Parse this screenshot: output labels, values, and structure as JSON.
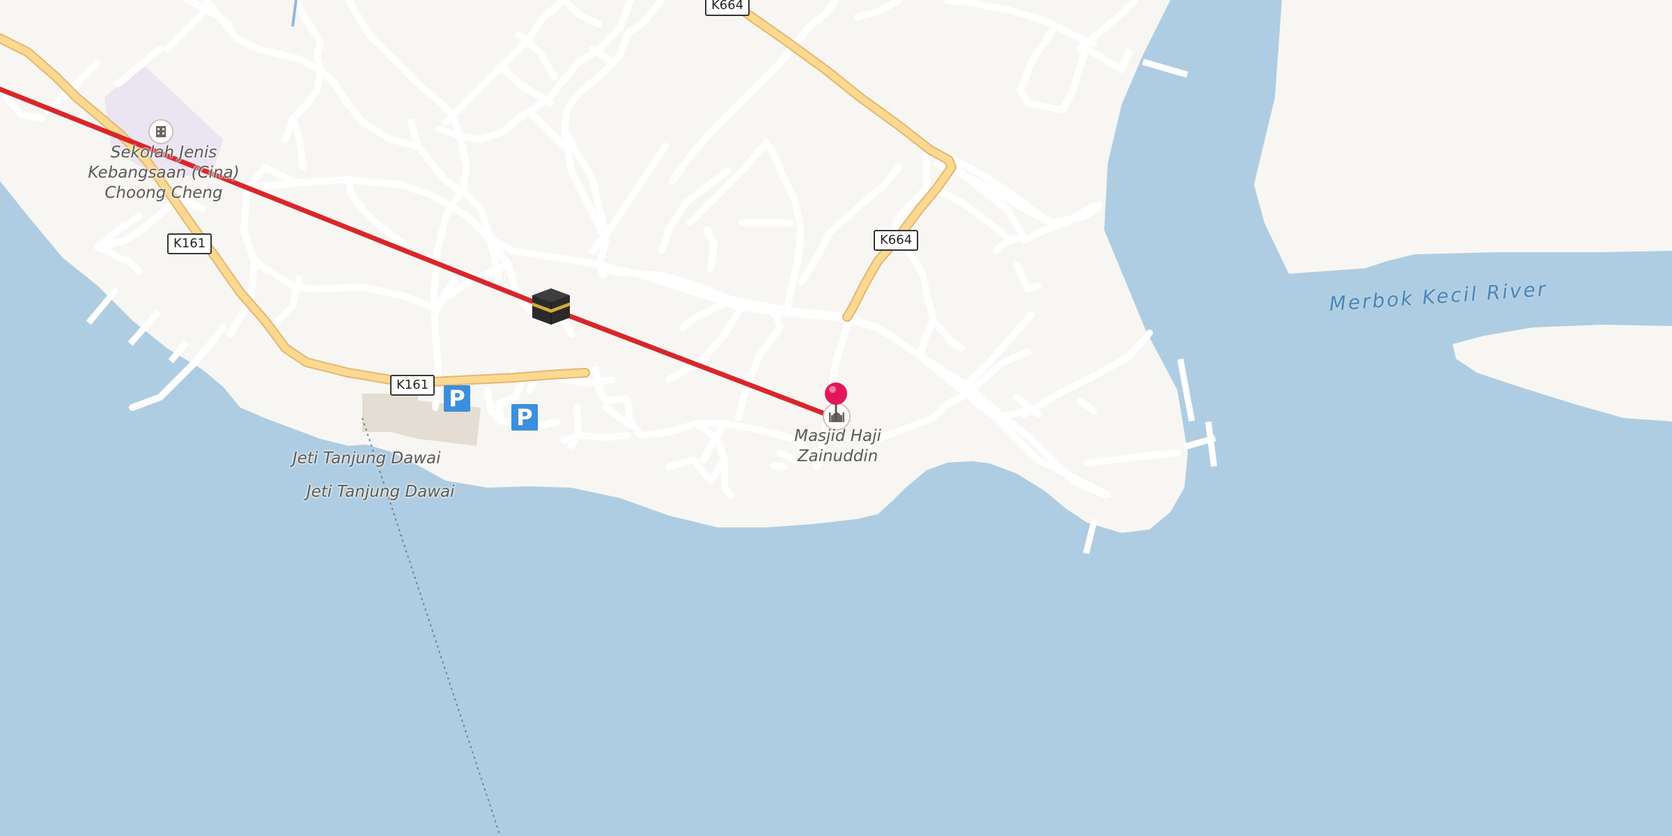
{
  "map": {
    "colors": {
      "water": "#aecde2",
      "land": "#f8f6f2",
      "road_minor": "#ffffff",
      "road_primary": "#fcd890",
      "road_primary_casing": "#e0b870",
      "route_line": "#d9262c",
      "pin": "#e3165b",
      "parking": "#3b8fde",
      "school_area": "#ebe4f2",
      "water_label": "#4a86b8",
      "place_label": "#5a5a5a"
    },
    "place_labels": {
      "school": "Sekolah Jenis Kebangsaan (Cina) Choong Cheng",
      "jetty_1": "Jeti Tanjung Dawai",
      "jetty_2": "Jeti Tanjung Dawai",
      "mosque": "Masjid Haji Zainuddin"
    },
    "school_label_lines": [
      "Sekolah Jenis",
      "Kebangsaan (Cina)",
      "Choong Cheng"
    ],
    "mosque_label_lines": [
      "Masjid Haji",
      "Zainuddin"
    ],
    "water_label": "Merbok Kecil River",
    "road_shields": {
      "k664_top": "K664",
      "k664_mid": "K664",
      "k161_left": "K161",
      "k161_bottom": "K161"
    },
    "parking_label": "P",
    "icons": {
      "school": "school-icon",
      "mosque": "mosque-icon",
      "origin": "kaaba-icon",
      "destination": "location-pin-icon",
      "parking": "parking-icon"
    }
  }
}
